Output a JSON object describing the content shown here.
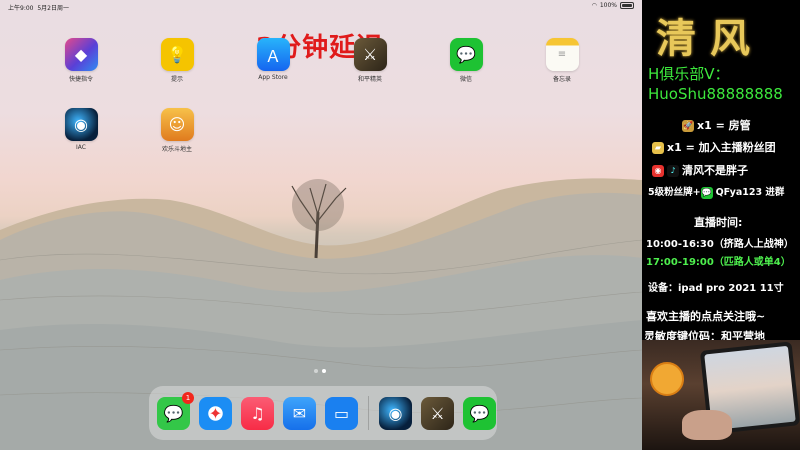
{
  "status_bar": {
    "time": "上午9:00",
    "date": "5月2日周一",
    "battery": "100%"
  },
  "stream_overlay": {
    "delay_notice": "3分钟延迟"
  },
  "home_apps": [
    {
      "label": "快捷指令",
      "icon": "shortcuts-icon",
      "color": "#5a3fd6"
    },
    {
      "label": "提示",
      "icon": "tips-icon",
      "color": "#f5c400"
    },
    {
      "label": "App Store",
      "icon": "app-store-icon",
      "color": "#1d8cf5"
    },
    {
      "label": "和平精英",
      "icon": "peace-elite-icon",
      "color": "#3a3a2a"
    },
    {
      "label": "微信",
      "icon": "wechat-icon",
      "color": "#1ec233"
    },
    {
      "label": "备忘录",
      "icon": "notes-icon",
      "color": "#f7f2dc"
    },
    {
      "label": "IAC",
      "icon": "iac-icon",
      "color": "#0a2a4a"
    },
    {
      "label": "欢乐斗地主",
      "icon": "dou-dizhu-icon",
      "color": "#f3a132"
    }
  ],
  "dock": [
    {
      "name": "messages",
      "icon": "messages-icon",
      "color": "#33c748",
      "badge": "1"
    },
    {
      "name": "safari",
      "icon": "safari-icon",
      "color": "#1b8df4"
    },
    {
      "name": "music",
      "icon": "music-icon",
      "color": "#fb3c52"
    },
    {
      "name": "mail",
      "icon": "mail-icon",
      "color": "#1f8bf3"
    },
    {
      "name": "files",
      "icon": "files-icon",
      "color": "#1a80f0"
    },
    {
      "name": "iac",
      "icon": "iac-icon",
      "color": "#0a2a4a"
    },
    {
      "name": "peace-elite",
      "icon": "peace-elite-icon",
      "color": "#3a3a2a"
    },
    {
      "name": "wechat",
      "icon": "wechat-icon",
      "color": "#1ec233"
    }
  ],
  "panel": {
    "title": "清风",
    "club_line1": "H俱乐部V：",
    "club_line2": "HuoShu88888888",
    "rocket_line": "x1 = 房管",
    "gift_line": "x1 = 加入主播粉丝团",
    "weibo_line": "清风不是胖子",
    "fan_line_prefix": "5级粉丝牌+",
    "fan_line_suffix": "QFya123 进群",
    "live_time_label": "直播时间:",
    "live_time_1": "10:00-16:30（挤路人上战神）",
    "live_time_2": "17:00-19:00（匹路人或单4）",
    "device_line": "设备：ipad pro 2021 11寸",
    "follow_line": "喜欢主播的点点关注哦~",
    "sensitivity_line": "灵敏度键位码：和平营地"
  }
}
